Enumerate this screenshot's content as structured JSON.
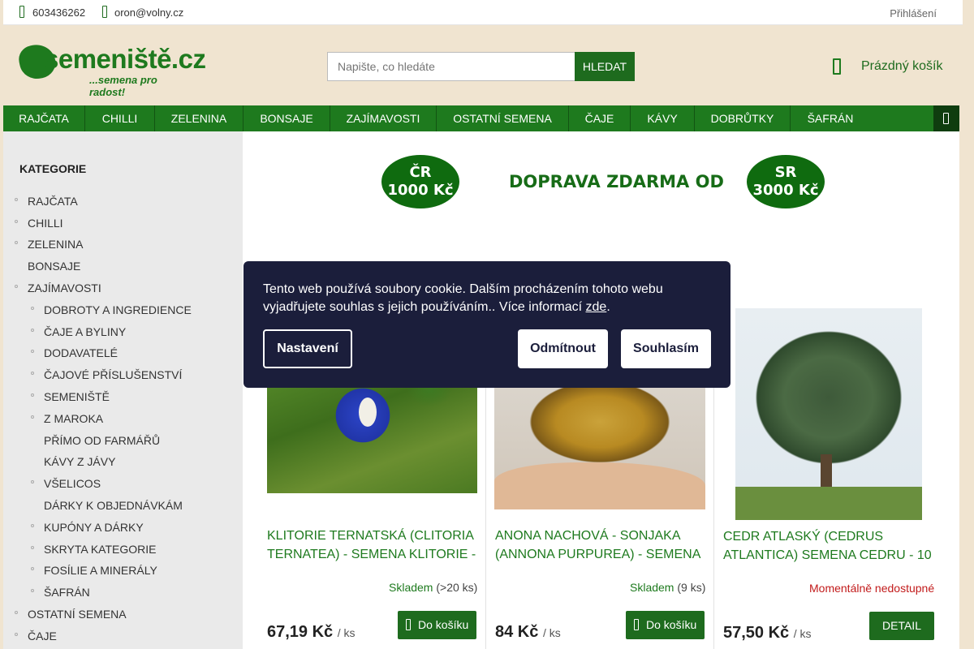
{
  "topbar": {
    "phone": "603436262",
    "email": "oron@volny.cz",
    "login": "Přihlášení"
  },
  "logo": {
    "name": "semeniště.cz",
    "tagline": "...semena pro radost!"
  },
  "search": {
    "placeholder": "Napište, co hledáte",
    "button": "HLEDAT"
  },
  "cart": {
    "label": "Prázdný košík"
  },
  "nav": {
    "items": [
      "RAJČATA",
      "CHILLI",
      "ZELENINA",
      "BONSAJE",
      "ZAJÍMAVOSTI",
      "OSTATNÍ SEMENA",
      "ČAJE",
      "KÁVY",
      "DOBRŮTKY",
      "ŠAFRÁN"
    ]
  },
  "sidebar": {
    "title": "KATEGORIE",
    "items": [
      {
        "label": "RAJČATA"
      },
      {
        "label": "CHILLI"
      },
      {
        "label": "ZELENINA"
      },
      {
        "label": "BONSAJE"
      },
      {
        "label": "ZAJÍMAVOSTI"
      },
      {
        "label": "DOBROTY A INGREDIENCE"
      },
      {
        "label": "ČAJE A BYLINY"
      },
      {
        "label": "DODAVATELÉ"
      },
      {
        "label": "ČAJOVÉ PŘÍSLUŠENSTVÍ"
      },
      {
        "label": "SEMENIŠTĚ"
      },
      {
        "label": "Z MAROKA"
      },
      {
        "label": "PŘÍMO OD FARMÁŘŮ"
      },
      {
        "label": "KÁVY Z JÁVY"
      },
      {
        "label": "VŠELICOS"
      },
      {
        "label": "DÁRKY K OBJEDNÁVKÁM"
      },
      {
        "label": "KUPÓNY A DÁRKY"
      },
      {
        "label": "SKRYTA KATEGORIE"
      },
      {
        "label": "FOSÍLIE A MINERÁLY"
      },
      {
        "label": "ŠAFRÁN"
      },
      {
        "label": "OSTATNÍ SEMENA"
      },
      {
        "label": "ČAJE"
      }
    ]
  },
  "banner": {
    "left_line1": "ČR",
    "left_line2": "1000 Kč",
    "middle": "DOPRAVA ZDARMA OD",
    "right_line1": "SR",
    "right_line2": "3000 Kč"
  },
  "cookie": {
    "text": "Tento web používá soubory cookie. Dalším procházením tohoto webu vyjadřujete souhlas s jejich používáním.. Více informací ",
    "link": "zde",
    "text_end": ".",
    "settings": "Nastavení",
    "reject": "Odmítnout",
    "accept": "Souhlasím"
  },
  "products": [
    {
      "title": "KLITORIE TERNATSKÁ (CLITORIA TERNATEA) - SEMENA KLITORIE -",
      "stock_status": "Skladem",
      "stock_qty": "(>20 ks)",
      "price": "67,19 Kč",
      "unit": "/ ks",
      "button": "Do košíku",
      "status_color": "#1e7a1e"
    },
    {
      "title": "ANONA NACHOVÁ - SONJAKA (ANNONA PURPUREA) - SEMENA",
      "stock_status": "Skladem",
      "stock_qty": "(9 ks)",
      "price": "84 Kč",
      "unit": "/ ks",
      "button": "Do košíku",
      "status_color": "#1e7a1e"
    },
    {
      "title": "CEDR ATLASKÝ (CEDRUS ATLANTICA) SEMENA CEDRU - 10",
      "stock_status": "Momentálně nedostupné",
      "price": "57,50 Kč",
      "unit": "/ ks",
      "button": "DETAIL",
      "status_color": "#c21b1b"
    }
  ],
  "colors": {
    "brand_green": "#1e7a1e",
    "background": "#f0e4d0",
    "cookie_bg": "#1b1e3b",
    "out_of_stock": "#c21b1b"
  },
  "icons": {
    "phone": "phone-icon",
    "email": "mail-icon",
    "cart": "cart-icon",
    "nav_more": "menu-icon"
  }
}
